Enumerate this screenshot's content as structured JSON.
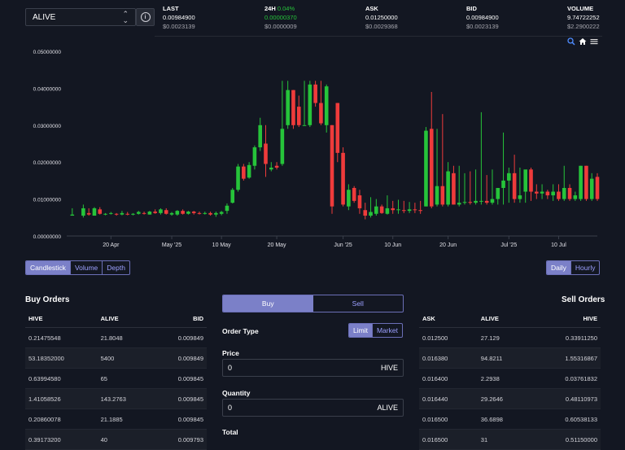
{
  "header": {
    "token": "ALIVE",
    "stats": [
      {
        "label": "LAST",
        "change": "",
        "value": "0.00984900",
        "sub": "$0.0023139"
      },
      {
        "label": "24H",
        "change": "0.04%",
        "value": "0.00000370",
        "sub": "$0.0000009"
      },
      {
        "label": "ASK",
        "change": "",
        "value": "0.01250000",
        "sub": "$0.0029368"
      },
      {
        "label": "BID",
        "change": "",
        "value": "0.00984900",
        "sub": "$0.0023139"
      },
      {
        "label": "VOLUME",
        "change": "",
        "value": "9.74722252",
        "sub": "$2.2900222"
      }
    ]
  },
  "chart": {
    "up_color": "#26c43a",
    "down_color": "#ef3b3b",
    "tools": [
      "zoom-icon",
      "home-icon",
      "menu-icon"
    ]
  },
  "chart_data": {
    "type": "candlestick",
    "y_ticks": [
      "0.05000000",
      "0.04000000",
      "0.03000000",
      "0.02000000",
      "0.01000000",
      "0.00000000"
    ],
    "ylim": [
      0,
      0.05
    ],
    "x_ticks": [
      "20 Apr",
      "May '25",
      "10 May",
      "20 May",
      "Jun '25",
      "10 Jun",
      "20 Jun",
      "Jul '25",
      "10 Jul"
    ],
    "start": "2025-04-12",
    "end": "2025-07-17",
    "candles": [
      {
        "d": "2025-04-13",
        "o": 0.0055,
        "h": 0.0075,
        "l": 0.0055,
        "c": 0.0058
      },
      {
        "d": "2025-04-15",
        "o": 0.0055,
        "h": 0.0085,
        "l": 0.005,
        "c": 0.0075
      },
      {
        "d": "2025-04-16",
        "o": 0.0062,
        "h": 0.0075,
        "l": 0.0055,
        "c": 0.0058
      },
      {
        "d": "2025-04-17",
        "o": 0.0055,
        "h": 0.0078,
        "l": 0.0055,
        "c": 0.0075
      },
      {
        "d": "2025-04-18",
        "o": 0.0072,
        "h": 0.0078,
        "l": 0.0058,
        "c": 0.006
      },
      {
        "d": "2025-04-19",
        "o": 0.0058,
        "h": 0.0062,
        "l": 0.0056,
        "c": 0.006
      },
      {
        "d": "2025-04-20",
        "o": 0.006,
        "h": 0.0065,
        "l": 0.0058,
        "c": 0.0062
      },
      {
        "d": "2025-04-21",
        "o": 0.006,
        "h": 0.0062,
        "l": 0.0055,
        "c": 0.0058
      },
      {
        "d": "2025-04-22",
        "o": 0.0058,
        "h": 0.0068,
        "l": 0.0056,
        "c": 0.0062
      },
      {
        "d": "2025-04-23",
        "o": 0.006,
        "h": 0.0065,
        "l": 0.0056,
        "c": 0.0058
      },
      {
        "d": "2025-04-24",
        "o": 0.0058,
        "h": 0.0062,
        "l": 0.0056,
        "c": 0.006
      },
      {
        "d": "2025-04-25",
        "o": 0.006,
        "h": 0.0068,
        "l": 0.0058,
        "c": 0.0065
      },
      {
        "d": "2025-04-26",
        "o": 0.0062,
        "h": 0.0066,
        "l": 0.0058,
        "c": 0.006
      },
      {
        "d": "2025-04-27",
        "o": 0.0058,
        "h": 0.0068,
        "l": 0.0058,
        "c": 0.0066
      },
      {
        "d": "2025-04-28",
        "o": 0.0066,
        "h": 0.0072,
        "l": 0.006,
        "c": 0.0062
      },
      {
        "d": "2025-04-29",
        "o": 0.0062,
        "h": 0.0075,
        "l": 0.0058,
        "c": 0.0072
      },
      {
        "d": "2025-04-30",
        "o": 0.007,
        "h": 0.0075,
        "l": 0.0058,
        "c": 0.006
      },
      {
        "d": "2025-05-01",
        "o": 0.0058,
        "h": 0.0065,
        "l": 0.0055,
        "c": 0.0062
      },
      {
        "d": "2025-05-02",
        "o": 0.0058,
        "h": 0.007,
        "l": 0.0055,
        "c": 0.0068
      },
      {
        "d": "2025-05-03",
        "o": 0.0068,
        "h": 0.0072,
        "l": 0.0058,
        "c": 0.006
      },
      {
        "d": "2025-05-04",
        "o": 0.006,
        "h": 0.0068,
        "l": 0.0058,
        "c": 0.0066
      },
      {
        "d": "2025-05-05",
        "o": 0.0066,
        "h": 0.0068,
        "l": 0.0058,
        "c": 0.0062
      },
      {
        "d": "2025-05-06",
        "o": 0.0062,
        "h": 0.0066,
        "l": 0.0058,
        "c": 0.006
      },
      {
        "d": "2025-05-07",
        "o": 0.006,
        "h": 0.0066,
        "l": 0.0058,
        "c": 0.0062
      },
      {
        "d": "2025-05-08",
        "o": 0.0062,
        "h": 0.0066,
        "l": 0.0055,
        "c": 0.0058
      },
      {
        "d": "2025-05-09",
        "o": 0.0058,
        "h": 0.0066,
        "l": 0.0052,
        "c": 0.0062
      },
      {
        "d": "2025-05-10",
        "o": 0.006,
        "h": 0.0068,
        "l": 0.0056,
        "c": 0.0065
      },
      {
        "d": "2025-05-11",
        "o": 0.0068,
        "h": 0.0088,
        "l": 0.006,
        "c": 0.0082
      },
      {
        "d": "2025-05-12",
        "o": 0.009,
        "h": 0.013,
        "l": 0.0088,
        "c": 0.0125
      },
      {
        "d": "2025-05-13",
        "o": 0.0125,
        "h": 0.0195,
        "l": 0.012,
        "c": 0.0188
      },
      {
        "d": "2025-05-14",
        "o": 0.0188,
        "h": 0.0195,
        "l": 0.015,
        "c": 0.0155
      },
      {
        "d": "2025-05-15",
        "o": 0.0158,
        "h": 0.02,
        "l": 0.0155,
        "c": 0.0192
      },
      {
        "d": "2025-05-16",
        "o": 0.019,
        "h": 0.0245,
        "l": 0.018,
        "c": 0.024
      },
      {
        "d": "2025-05-17",
        "o": 0.024,
        "h": 0.032,
        "l": 0.023,
        "c": 0.03
      },
      {
        "d": "2025-05-18",
        "o": 0.025,
        "h": 0.03,
        "l": 0.016,
        "c": 0.0195
      },
      {
        "d": "2025-05-19",
        "o": 0.018,
        "h": 0.02,
        "l": 0.0175,
        "c": 0.0185
      },
      {
        "d": "2025-05-20",
        "o": 0.019,
        "h": 0.02,
        "l": 0.018,
        "c": 0.0185
      },
      {
        "d": "2025-05-21",
        "o": 0.0195,
        "h": 0.042,
        "l": 0.019,
        "c": 0.029
      },
      {
        "d": "2025-05-22",
        "o": 0.03,
        "h": 0.042,
        "l": 0.029,
        "c": 0.0395
      },
      {
        "d": "2025-05-23",
        "o": 0.0395,
        "h": 0.0395,
        "l": 0.029,
        "c": 0.03
      },
      {
        "d": "2025-05-24",
        "o": 0.035,
        "h": 0.038,
        "l": 0.0295,
        "c": 0.03
      },
      {
        "d": "2025-05-25",
        "o": 0.03,
        "h": 0.042,
        "l": 0.03,
        "c": 0.03
      },
      {
        "d": "2025-05-26",
        "o": 0.03,
        "h": 0.042,
        "l": 0.0295,
        "c": 0.041
      },
      {
        "d": "2025-05-27",
        "o": 0.041,
        "h": 0.042,
        "l": 0.035,
        "c": 0.036
      },
      {
        "d": "2025-05-28",
        "o": 0.036,
        "h": 0.042,
        "l": 0.03,
        "c": 0.0305
      },
      {
        "d": "2025-05-29",
        "o": 0.03,
        "h": 0.041,
        "l": 0.028,
        "c": 0.0405
      },
      {
        "d": "2025-05-30",
        "o": 0.03,
        "h": 0.03,
        "l": 0.006,
        "c": 0.008
      },
      {
        "d": "2025-05-31",
        "o": 0.036,
        "h": 0.036,
        "l": 0.02,
        "c": 0.0225
      },
      {
        "d": "2025-06-01",
        "o": 0.0225,
        "h": 0.024,
        "l": 0.008,
        "c": 0.0085
      },
      {
        "d": "2025-06-02",
        "o": 0.008,
        "h": 0.014,
        "l": 0.007,
        "c": 0.0125
      },
      {
        "d": "2025-06-03",
        "o": 0.013,
        "h": 0.0135,
        "l": 0.009,
        "c": 0.0095
      },
      {
        "d": "2025-06-04",
        "o": 0.011,
        "h": 0.0125,
        "l": 0.006,
        "c": 0.0075
      },
      {
        "d": "2025-06-05",
        "o": 0.007,
        "h": 0.009,
        "l": 0.0045,
        "c": 0.0055
      },
      {
        "d": "2025-06-06",
        "o": 0.0055,
        "h": 0.0105,
        "l": 0.005,
        "c": 0.0065
      },
      {
        "d": "2025-06-07",
        "o": 0.006,
        "h": 0.01,
        "l": 0.0055,
        "c": 0.008
      },
      {
        "d": "2025-06-08",
        "o": 0.008,
        "h": 0.0085,
        "l": 0.006,
        "c": 0.0062
      },
      {
        "d": "2025-06-09",
        "o": 0.006,
        "h": 0.011,
        "l": 0.0058,
        "c": 0.0075
      },
      {
        "d": "2025-06-10",
        "o": 0.0075,
        "h": 0.0095,
        "l": 0.006,
        "c": 0.007
      },
      {
        "d": "2025-06-11",
        "o": 0.007,
        "h": 0.0098,
        "l": 0.006,
        "c": 0.0072
      },
      {
        "d": "2025-06-12",
        "o": 0.007,
        "h": 0.0095,
        "l": 0.0062,
        "c": 0.0068
      },
      {
        "d": "2025-06-13",
        "o": 0.0068,
        "h": 0.0092,
        "l": 0.0062,
        "c": 0.0072
      },
      {
        "d": "2025-06-14",
        "o": 0.0072,
        "h": 0.009,
        "l": 0.0062,
        "c": 0.007
      },
      {
        "d": "2025-06-15",
        "o": 0.007,
        "h": 0.0095,
        "l": 0.006,
        "c": 0.0068
      },
      {
        "d": "2025-06-16",
        "o": 0.008,
        "h": 0.0295,
        "l": 0.008,
        "c": 0.0285
      },
      {
        "d": "2025-06-17",
        "o": 0.029,
        "h": 0.039,
        "l": 0.0075,
        "c": 0.008
      },
      {
        "d": "2025-06-18",
        "o": 0.0085,
        "h": 0.029,
        "l": 0.008,
        "c": 0.0135
      },
      {
        "d": "2025-06-19",
        "o": 0.0135,
        "h": 0.033,
        "l": 0.008,
        "c": 0.0085
      },
      {
        "d": "2025-06-20",
        "o": 0.0085,
        "h": 0.02,
        "l": 0.008,
        "c": 0.0175
      },
      {
        "d": "2025-06-21",
        "o": 0.017,
        "h": 0.019,
        "l": 0.0085,
        "c": 0.0085
      },
      {
        "d": "2025-06-22",
        "o": 0.0085,
        "h": 0.019,
        "l": 0.008,
        "c": 0.009
      },
      {
        "d": "2025-06-23",
        "o": 0.009,
        "h": 0.017,
        "l": 0.0085,
        "c": 0.0092
      },
      {
        "d": "2025-06-24",
        "o": 0.0092,
        "h": 0.0175,
        "l": 0.0085,
        "c": 0.009
      },
      {
        "d": "2025-06-25",
        "o": 0.009,
        "h": 0.018,
        "l": 0.0085,
        "c": 0.0095
      },
      {
        "d": "2025-06-26",
        "o": 0.0095,
        "h": 0.0335,
        "l": 0.0085,
        "c": 0.0095
      },
      {
        "d": "2025-06-27",
        "o": 0.0095,
        "h": 0.0165,
        "l": 0.0085,
        "c": 0.009
      },
      {
        "d": "2025-06-28",
        "o": 0.009,
        "h": 0.018,
        "l": 0.0085,
        "c": 0.01
      },
      {
        "d": "2025-06-29",
        "o": 0.01,
        "h": 0.013,
        "l": 0.0085,
        "c": 0.013
      },
      {
        "d": "2025-06-30",
        "o": 0.013,
        "h": 0.028,
        "l": 0.0085,
        "c": 0.015
      },
      {
        "d": "2025-07-01",
        "o": 0.015,
        "h": 0.0185,
        "l": 0.009,
        "c": 0.017
      },
      {
        "d": "2025-07-02",
        "o": 0.017,
        "h": 0.022,
        "l": 0.009,
        "c": 0.01
      },
      {
        "d": "2025-07-03",
        "o": 0.01,
        "h": 0.0185,
        "l": 0.009,
        "c": 0.011
      },
      {
        "d": "2025-07-04",
        "o": 0.012,
        "h": 0.0175,
        "l": 0.009,
        "c": 0.018
      },
      {
        "d": "2025-07-05",
        "o": 0.018,
        "h": 0.0185,
        "l": 0.0095,
        "c": 0.012
      },
      {
        "d": "2025-07-06",
        "o": 0.012,
        "h": 0.014,
        "l": 0.01,
        "c": 0.0115
      },
      {
        "d": "2025-07-07",
        "o": 0.0115,
        "h": 0.014,
        "l": 0.01,
        "c": 0.012
      },
      {
        "d": "2025-07-08",
        "o": 0.012,
        "h": 0.0125,
        "l": 0.01,
        "c": 0.011
      },
      {
        "d": "2025-07-09",
        "o": 0.011,
        "h": 0.014,
        "l": 0.0095,
        "c": 0.012
      },
      {
        "d": "2025-07-10",
        "o": 0.012,
        "h": 0.014,
        "l": 0.0095,
        "c": 0.01
      },
      {
        "d": "2025-07-11",
        "o": 0.01,
        "h": 0.019,
        "l": 0.0095,
        "c": 0.013
      },
      {
        "d": "2025-07-12",
        "o": 0.013,
        "h": 0.014,
        "l": 0.0095,
        "c": 0.01
      },
      {
        "d": "2025-07-13",
        "o": 0.01,
        "h": 0.012,
        "l": 0.0095,
        "c": 0.011
      },
      {
        "d": "2025-07-14",
        "o": 0.01,
        "h": 0.019,
        "l": 0.0095,
        "c": 0.019
      },
      {
        "d": "2025-07-15",
        "o": 0.019,
        "h": 0.019,
        "l": 0.0095,
        "c": 0.01
      },
      {
        "d": "2025-07-16",
        "o": 0.01,
        "h": 0.017,
        "l": 0.0095,
        "c": 0.0155
      },
      {
        "d": "2025-07-17",
        "o": 0.016,
        "h": 0.017,
        "l": 0.0095,
        "c": 0.01
      }
    ]
  },
  "chart_type_tabs": {
    "candlestick": "Candlestick",
    "volume": "Volume",
    "depth": "Depth"
  },
  "interval_tabs": {
    "daily": "Daily",
    "hourly": "Hourly"
  },
  "buy_orders": {
    "title": "Buy Orders",
    "columns": [
      "HIVE",
      "ALIVE",
      "BID"
    ],
    "rows": [
      [
        "0.21475548",
        "21.8048",
        "0.009849"
      ],
      [
        "53.18352000",
        "5400",
        "0.009849"
      ],
      [
        "0.63994580",
        "65",
        "0.009845"
      ],
      [
        "1.41058526",
        "143.2763",
        "0.009845"
      ],
      [
        "0.20860078",
        "21.1885",
        "0.009845"
      ],
      [
        "0.39173200",
        "40",
        "0.009793"
      ]
    ]
  },
  "sell_orders": {
    "title": "Sell Orders",
    "columns": [
      "ASK",
      "ALIVE",
      "HIVE"
    ],
    "rows": [
      [
        "0.012500",
        "27.129",
        "0.33911250"
      ],
      [
        "0.016380",
        "94.8211",
        "1.55316867"
      ],
      [
        "0.016400",
        "2.2938",
        "0.03761832"
      ],
      [
        "0.016440",
        "29.2646",
        "0.48110973"
      ],
      [
        "0.016500",
        "36.6898",
        "0.60538133"
      ],
      [
        "0.016500",
        "31",
        "0.51150000"
      ]
    ]
  },
  "order_form": {
    "buy_tab": "Buy",
    "sell_tab": "Sell",
    "order_type_label": "Order Type",
    "limit": "Limit",
    "market": "Market",
    "price_label": "Price",
    "price_value": "0",
    "price_unit": "HIVE",
    "quantity_label": "Quantity",
    "quantity_value": "0",
    "quantity_unit": "ALIVE",
    "total_label": "Total"
  }
}
